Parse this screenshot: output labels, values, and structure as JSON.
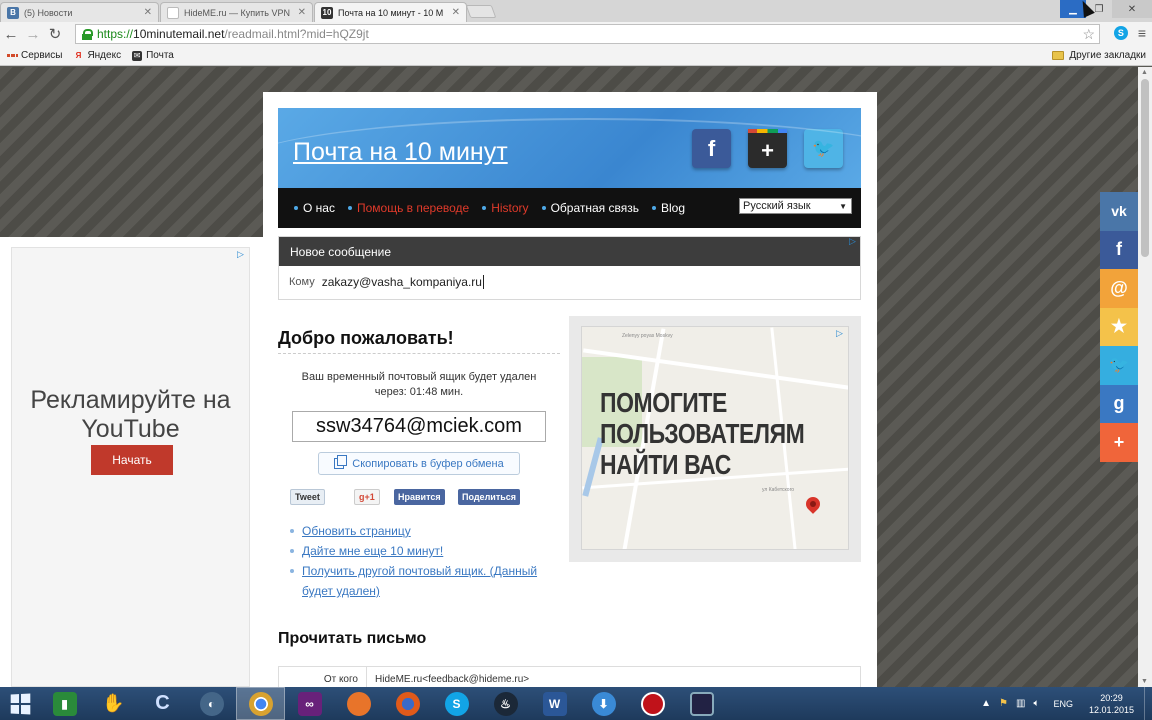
{
  "browser": {
    "tabs": [
      {
        "title": "(5) Новости",
        "favicon": "vk-icon",
        "favicon_text": "В",
        "color": "#4a76a8",
        "active": false
      },
      {
        "title": "HideME.ru — Купить VPN",
        "favicon": "page-icon",
        "favicon_text": "",
        "color": "#cccccc",
        "active": false
      },
      {
        "title": "Почта на 10 минут - 10 М",
        "favicon": "tenmin-icon",
        "favicon_text": "10",
        "color": "#333333",
        "active": true
      }
    ],
    "url": {
      "scheme": "https://",
      "host": "10minutemail.net",
      "path": "/readmail.html?mid=hQZ9jt"
    },
    "bookmarks": [
      {
        "label": "Сервисы",
        "icon": "apps-icon"
      },
      {
        "label": "Яндекс",
        "icon": "yandex-icon"
      },
      {
        "label": "Почта",
        "icon": "mail-icon"
      }
    ],
    "other_bookmarks": "Другие закладки"
  },
  "ad_left": {
    "text": "Рекламируйте на YouTube",
    "button": "Начать"
  },
  "site": {
    "logo": "Почта на 10 минут",
    "social": [
      {
        "name": "facebook",
        "glyph": "f"
      },
      {
        "name": "google-plus",
        "glyph": "+"
      },
      {
        "name": "twitter",
        "glyph": "🐦"
      }
    ],
    "nav": [
      {
        "label": "О нас",
        "highlight": false
      },
      {
        "label": "Помощь в переводе",
        "highlight": true
      },
      {
        "label": "History",
        "highlight": true
      },
      {
        "label": "Обратная связь",
        "highlight": false
      },
      {
        "label": "Blog",
        "highlight": false
      }
    ],
    "language": "Русский язык",
    "new_message": {
      "title": "Новое сообщение",
      "to_label": "Кому",
      "to_value": "zakazy@vasha_kompaniya.ru"
    },
    "welcome": {
      "title": "Добро пожаловать!",
      "note_line1": "Ваш временный почтовый ящик будет удален",
      "note_line2": "через: 01:48 мин.",
      "mailbox": "ssw34764@mciek.com",
      "copy_button": "Скопировать в буфер обмена"
    },
    "share": {
      "tweet": "Tweet",
      "gplus": "g+1",
      "like": "Нравится",
      "share": "Поделиться"
    },
    "links": [
      "Обновить страницу",
      "Дайте мне еще 10 минут!",
      "Получить другой почтовый ящик. (Данный будет удален)"
    ],
    "map_ad": {
      "headline": "ПОМОГИТЕ ПОЛЬЗОВАТЕЛЯМ НАЙТИ ВАС",
      "map_label_1": "Zelenyy poyas Moskvy",
      "map_label_2": "ул Кабетского"
    },
    "read_title": "Прочитать письмо",
    "from_label": "От кого",
    "from_value": "HideME.ru<feedback@hideme.ru>"
  },
  "side_social": [
    {
      "name": "vk",
      "glyph": "vk",
      "color": "#4a76a8"
    },
    {
      "name": "facebook",
      "glyph": "f",
      "color": "#3b5a99"
    },
    {
      "name": "mailru",
      "glyph": "@",
      "color": "#f2a33a"
    },
    {
      "name": "favorites",
      "glyph": "★",
      "color": "#f4c24a"
    },
    {
      "name": "twitter",
      "glyph": "🐦",
      "color": "#35aee0"
    },
    {
      "name": "google",
      "glyph": "g",
      "color": "#3a78c2"
    },
    {
      "name": "more",
      "glyph": "+",
      "color": "#f0653a"
    }
  ],
  "taskbar": {
    "apps": [
      {
        "name": "resource-monitor",
        "color": "#2a8a3a",
        "glyph": "▮",
        "active": false
      },
      {
        "name": "recorder",
        "color": "#c0392b",
        "glyph": "✋",
        "active": false
      },
      {
        "name": "cleaner",
        "color": "#5a8ad6",
        "glyph": "C",
        "active": false
      },
      {
        "name": "speedfan",
        "color": "#446688",
        "glyph": "◐",
        "active": false
      },
      {
        "name": "chrome",
        "color": "#d8a230",
        "glyph": "◉",
        "active": true
      },
      {
        "name": "visual-studio",
        "color": "#68217a",
        "glyph": "∞",
        "active": false
      },
      {
        "name": "firefox-orange",
        "color": "#e8742a",
        "glyph": "●",
        "active": false
      },
      {
        "name": "firefox",
        "color": "#e05a1a",
        "glyph": "◕",
        "active": false
      },
      {
        "name": "skype",
        "color": "#12a4e6",
        "glyph": "S",
        "active": false
      },
      {
        "name": "steam",
        "color": "#1b2838",
        "glyph": "♨",
        "active": false
      },
      {
        "name": "word",
        "color": "#2b5797",
        "glyph": "W",
        "active": false
      },
      {
        "name": "downloader",
        "color": "#3a8ad6",
        "glyph": "⬇",
        "active": false
      },
      {
        "name": "record-button",
        "color": "#c0121a",
        "glyph": "●",
        "active": false
      },
      {
        "name": "remote-desktop",
        "color": "#222244",
        "glyph": "▭",
        "active": false
      }
    ],
    "lang": "ENG",
    "time": "20:29",
    "date": "12.01.2015"
  }
}
